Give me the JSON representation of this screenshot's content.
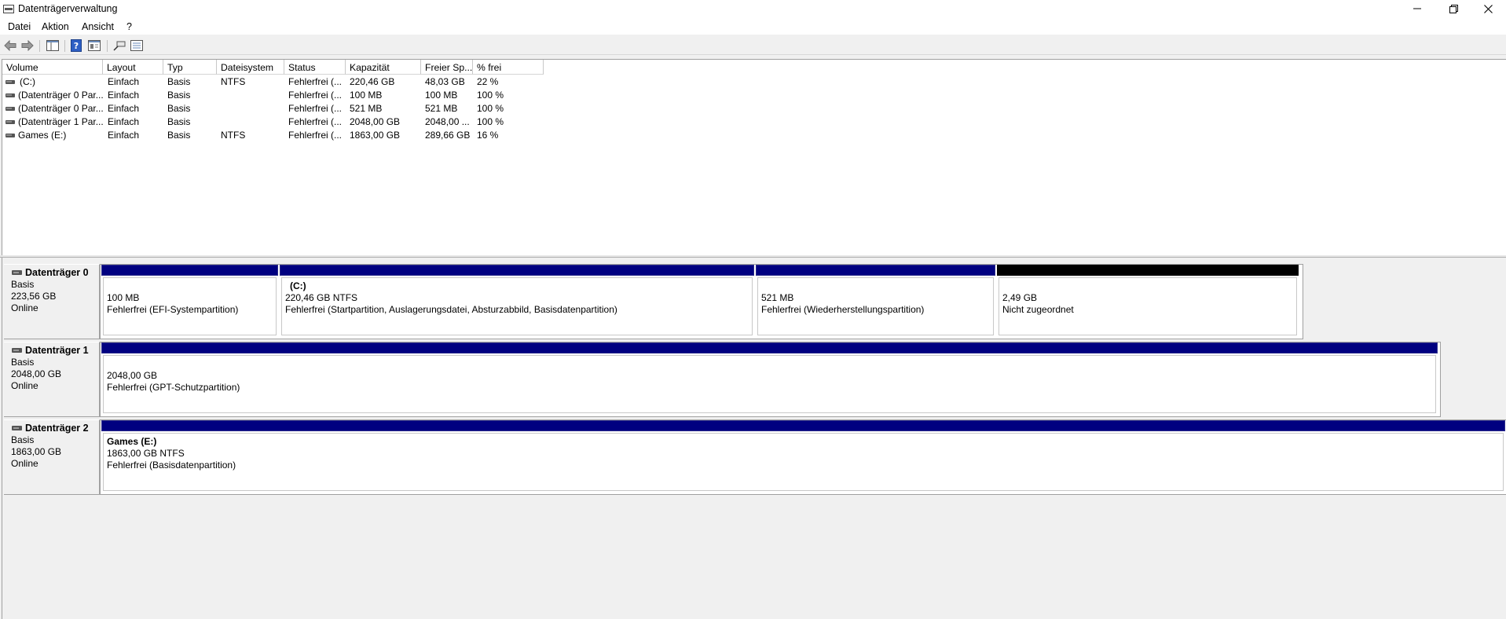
{
  "window": {
    "title": "Datenträgerverwaltung"
  },
  "menu": [
    "Datei",
    "Aktion",
    "Ansicht",
    "?"
  ],
  "columns": [
    "Volume",
    "Layout",
    "Typ",
    "Dateisystem",
    "Status",
    "Kapazität",
    "Freier Sp...",
    "% frei"
  ],
  "volumes": [
    {
      "volume": "(C:)",
      "layout": "Einfach",
      "typ": "Basis",
      "fs": "NTFS",
      "status": "Fehlerfrei (...",
      "kap": "220,46 GB",
      "frei": "48,03 GB",
      "pct": "22 %"
    },
    {
      "volume": "(Datenträger 0 Par...",
      "layout": "Einfach",
      "typ": "Basis",
      "fs": "",
      "status": "Fehlerfrei (...",
      "kap": "100 MB",
      "frei": "100 MB",
      "pct": "100 %"
    },
    {
      "volume": "(Datenträger 0 Par...",
      "layout": "Einfach",
      "typ": "Basis",
      "fs": "",
      "status": "Fehlerfrei (...",
      "kap": "521 MB",
      "frei": "521 MB",
      "pct": "100 %"
    },
    {
      "volume": "(Datenträger 1 Par...",
      "layout": "Einfach",
      "typ": "Basis",
      "fs": "",
      "status": "Fehlerfrei (...",
      "kap": "2048,00 GB",
      "frei": "2048,00 ...",
      "pct": "100 %"
    },
    {
      "volume": "Games (E:)",
      "layout": "Einfach",
      "typ": "Basis",
      "fs": "NTFS",
      "status": "Fehlerfrei (...",
      "kap": "1863,00 GB",
      "frei": "289,66 GB",
      "pct": "16 %"
    }
  ],
  "disks": [
    {
      "name": "Datenträger 0",
      "type": "Basis",
      "size": "223,56 GB",
      "state": "Online",
      "partitions": [
        {
          "title": "",
          "line1": "100 MB",
          "line2": "Fehlerfrei (EFI-Systempartition)",
          "unallocated": false
        },
        {
          "title": "(C:)",
          "line1": "220,46 GB NTFS",
          "line2": "Fehlerfrei (Startpartition, Auslagerungsdatei, Absturzabbild, Basisdatenpartition)",
          "unallocated": false
        },
        {
          "title": "",
          "line1": "521 MB",
          "line2": "Fehlerfrei (Wiederherstellungspartition)",
          "unallocated": false
        },
        {
          "title": "",
          "line1": "2,49 GB",
          "line2": "Nicht zugeordnet",
          "unallocated": true
        }
      ]
    },
    {
      "name": "Datenträger 1",
      "type": "Basis",
      "size": "2048,00 GB",
      "state": "Online",
      "partitions": [
        {
          "title": "",
          "line1": "2048,00 GB",
          "line2": "Fehlerfrei (GPT-Schutzpartition)",
          "unallocated": false
        }
      ]
    },
    {
      "name": "Datenträger 2",
      "type": "Basis",
      "size": "1863,00 GB",
      "state": "Online",
      "partitions": [
        {
          "title": "Games  (E:)",
          "line1": "1863,00 GB NTFS",
          "line2": "Fehlerfrei (Basisdatenpartition)",
          "unallocated": false
        }
      ]
    }
  ]
}
